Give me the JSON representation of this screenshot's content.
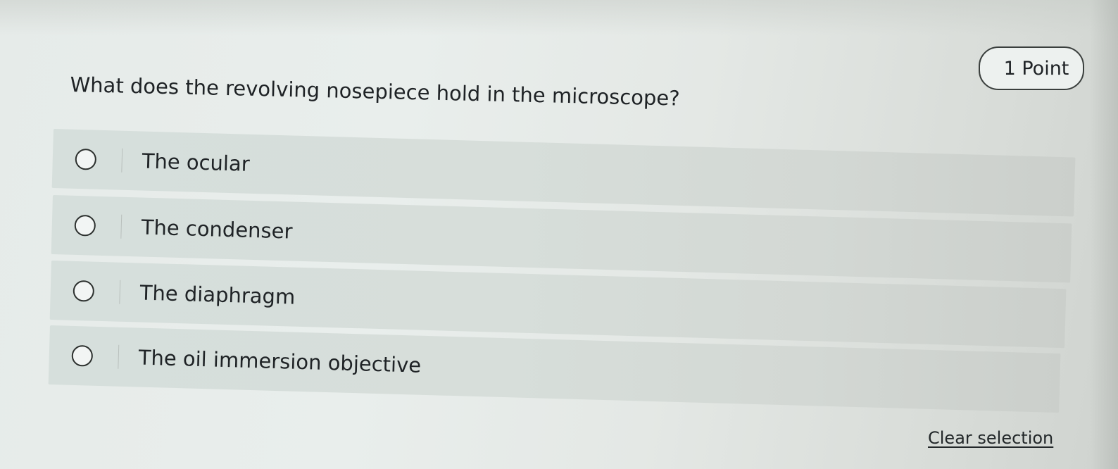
{
  "points": "1 Point",
  "question": "What does the revolving nosepiece hold in the microscope?",
  "options": [
    {
      "label": "The ocular",
      "selected": false
    },
    {
      "label": "The condenser",
      "selected": false
    },
    {
      "label": "The diaphragm",
      "selected": false
    },
    {
      "label": "The oil immersion objective",
      "selected": false
    }
  ],
  "clear_selection": "Clear selection"
}
